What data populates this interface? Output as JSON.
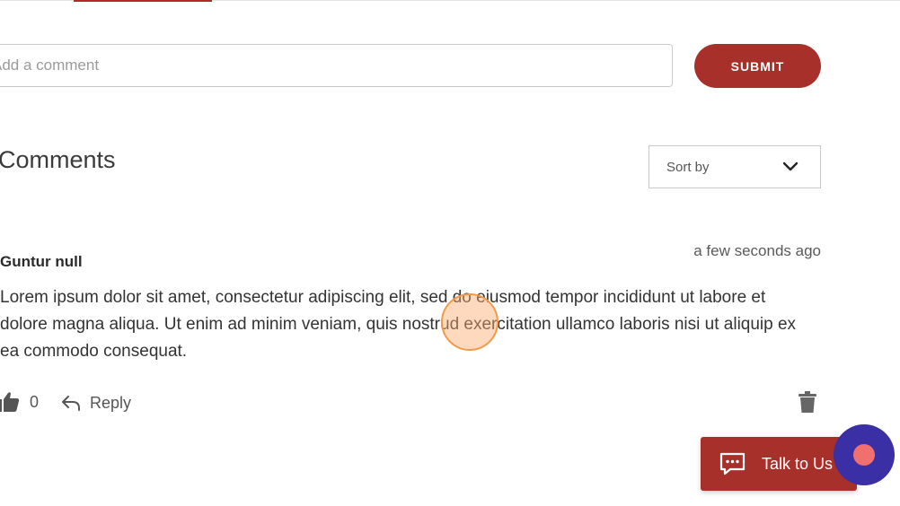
{
  "comment_form": {
    "placeholder": "Add a comment",
    "submit_label": "SUBMIT"
  },
  "comments_section": {
    "heading": "Comments",
    "sort": {
      "label": "Sort by"
    }
  },
  "comment": {
    "author": "Guntur null",
    "timestamp": "a few seconds ago",
    "body": "Lorem ipsum dolor sit amet, consectetur adipiscing elit, sed do eiusmod tempor incididunt ut labore et dolore magna aliqua. Ut enim ad minim veniam, quis nostrud exercitation ullamco laboris nisi ut aliquip ex ea commodo consequat.",
    "like_count": "0",
    "reply_label": "Reply"
  },
  "chat_widget": {
    "label": "Talk to Us"
  },
  "icons": {
    "like": "thumbs-up-icon",
    "reply": "reply-arrow-icon",
    "delete": "trash-icon",
    "sort": "chevron-down-icon",
    "chat": "chat-bubble-icon",
    "record": "record-dot-icon"
  },
  "colors": {
    "accent": "#a8302a",
    "recorder": "#3a2fa4",
    "record_dot": "#f07070"
  }
}
